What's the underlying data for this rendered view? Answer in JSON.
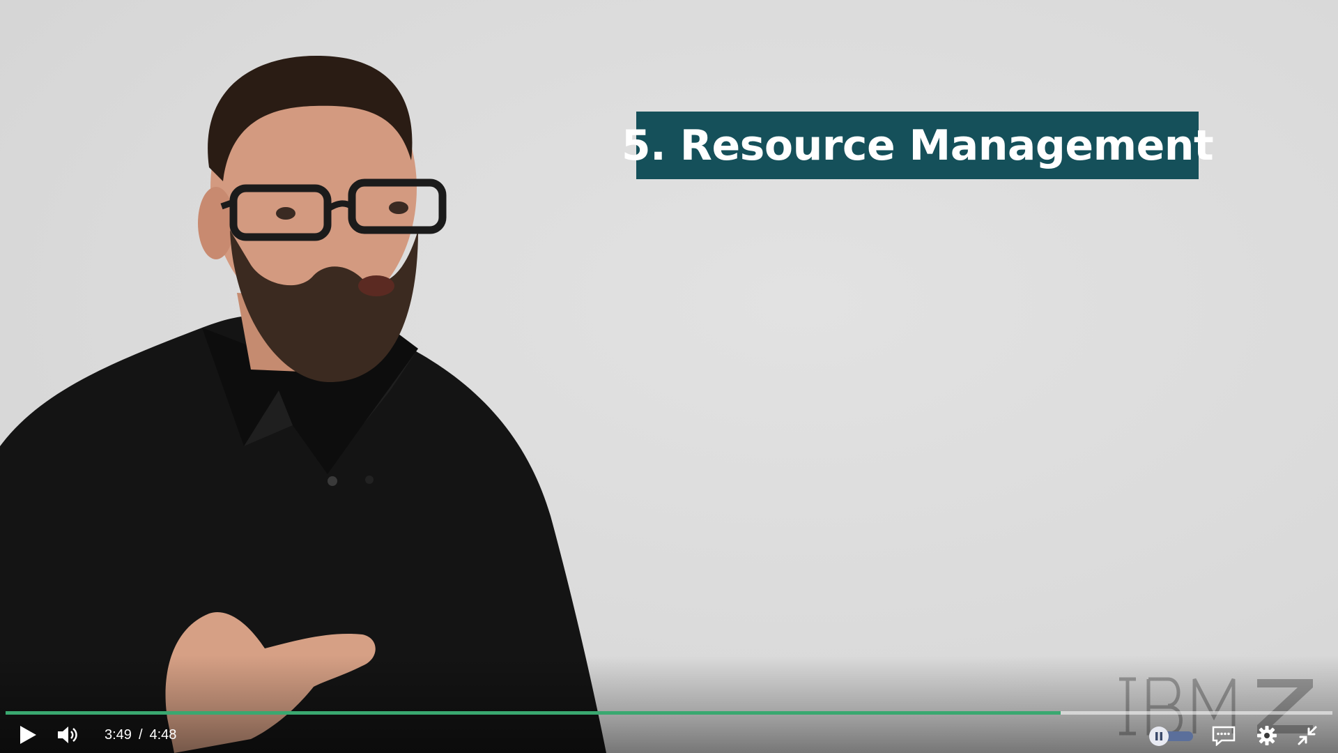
{
  "video": {
    "title_card_text": "5. Resource Management",
    "watermark_logo_text": "IBM Z",
    "progress_fraction": 0.795
  },
  "controls": {
    "current_time": "3:49",
    "separator": "/",
    "duration": "4:48",
    "icons": {
      "play": "play-icon",
      "volume": "volume-icon",
      "speed": "speed-toggle-icon",
      "captions": "closed-captions-icon",
      "settings": "gear-icon",
      "fullscreen": "exit-fullscreen-icon"
    }
  },
  "colors": {
    "title_card_bg": "#15505a",
    "progress_played": "#3aa870",
    "progress_track": "#ffffff"
  }
}
